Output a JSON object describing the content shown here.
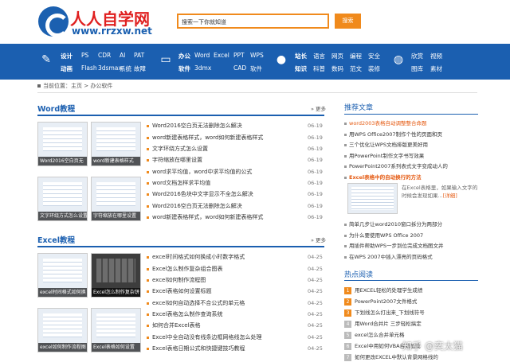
{
  "header": {
    "logo_cn": "人人自学网",
    "logo_en": "www.rrzxw.net",
    "search_placeholder": "搜索一下你就知道",
    "search_button": "搜索"
  },
  "nav": {
    "groups": [
      {
        "icon": "palette-icon",
        "icon_char": "✎",
        "title": "设计",
        "title2": "动画",
        "links": [
          "PS",
          "CDR",
          "AI",
          "PAT",
          "Flash",
          "3dsmax",
          "系统",
          "故障"
        ]
      },
      {
        "icon": "monitor-icon",
        "icon_char": "▭",
        "title": "办公",
        "title2": "软件",
        "links": [
          "Word",
          "Excel",
          "PPT",
          "WPS",
          "3dmx",
          "CAD",
          "软件"
        ]
      },
      {
        "icon": "chat-icon",
        "icon_char": "●",
        "title": "站长",
        "title2": "知识",
        "links": [
          "语言",
          "网页",
          "编程",
          "安全",
          "科普",
          "数码",
          "范文",
          "装修"
        ]
      },
      {
        "icon": "globe-icon",
        "icon_char": "◍",
        "title": "",
        "title2": "",
        "links": [
          "欣赏",
          "视频",
          "图库",
          "素材"
        ]
      }
    ]
  },
  "breadcrumb": {
    "label": "当前位置：",
    "home": "主页",
    "sep": " > ",
    "current": "办公软件"
  },
  "word": {
    "title": "Word教程",
    "more": "更多",
    "thumbs": [
      "Word2016空白页无",
      "word新建表格样式",
      "文字环绕方式怎么设置",
      "字符缩放在哪里设置"
    ],
    "articles": [
      {
        "title": "Word2016空白页无法删除怎么解决",
        "date": "06-19"
      },
      {
        "title": "word新建表格样式，word如何新建表格样式",
        "date": "06-19"
      },
      {
        "title": "文字环绕方式怎么设置",
        "date": "06-19"
      },
      {
        "title": "字符缩放在哪里设置",
        "date": "06-19"
      },
      {
        "title": "word求平均值，word中求平均值的公式",
        "date": "06-19"
      },
      {
        "title": "word文档怎样求平均值",
        "date": "06-19"
      },
      {
        "title": "Word2016色块中文字显示不全怎么解决",
        "date": "06-19"
      },
      {
        "title": "Word2016空白页无法删除怎么解决",
        "date": "06-19"
      },
      {
        "title": "word新建表格样式，word如何新建表格样式",
        "date": "06-19"
      }
    ]
  },
  "excel": {
    "title": "Excel教程",
    "more": "更多",
    "thumbs": [
      "excel时间格式如何换",
      "Excel怎么制作复杂饼",
      "excel如何制作流程图",
      "Excel表格如何设置"
    ],
    "articles": [
      {
        "title": "excel时间格式如何换成小时数字格式",
        "date": "04-25"
      },
      {
        "title": "Excel怎么制作复杂组合图表",
        "date": "04-25"
      },
      {
        "title": "excel如何制作流程图",
        "date": "04-25"
      },
      {
        "title": "Excel表格如何设置标题",
        "date": "04-25"
      },
      {
        "title": "excel如何自动选择不合公式的单元格",
        "date": "04-25"
      },
      {
        "title": "Excel表格怎么制作查询系统",
        "date": "04-25"
      },
      {
        "title": "如何合并Excel表格",
        "date": "04-25"
      },
      {
        "title": "Excel中全自动没有线条边框网格线怎么处理",
        "date": "04-25"
      },
      {
        "title": "Excel表格日期公式和快捷键技巧教程",
        "date": "04-25"
      }
    ]
  },
  "recommend": {
    "title": "推荐文章",
    "items": [
      {
        "text": "word2003表格自动调整整合命题",
        "style": "hl"
      },
      {
        "text": "用WPS Office2007制作个性的页面和页",
        "style": ""
      },
      {
        "text": "三个优化让WPS文档排版更美好用",
        "style": ""
      },
      {
        "text": "用PowerPoint制作文字书写效果",
        "style": ""
      },
      {
        "text": "PowerPoint2007系列表式文字变成动人的",
        "style": ""
      },
      {
        "text": "Excel表格中的自动换行的方法",
        "style": "hl bold"
      }
    ],
    "featured_desc": "在Excel表格里，如果输入文字的时候会发现如果...",
    "featured_link": "[详细]",
    "items2": [
      {
        "text": "简单几步让word2010窗口拆分为两部分"
      },
      {
        "text": "为什么要使用WPS Office 2007"
      },
      {
        "text": "用插件帮助WPS一步到位完成文档图文并"
      },
      {
        "text": "在WPS 2007中插入漂亮的页码格式"
      }
    ]
  },
  "hot": {
    "title": "热点阅读",
    "items": [
      {
        "num": "1",
        "text": "用EXCEL轻松的处理学生成绩"
      },
      {
        "num": "2",
        "text": "PowerPoint2007文件格式"
      },
      {
        "num": "3",
        "text": "下划线怎么打出来_下划线符号"
      },
      {
        "num": "4",
        "text": "用Word合并片 三步轻松搞定"
      },
      {
        "num": "5",
        "text": "excel怎么合并单元格"
      },
      {
        "num": "6",
        "text": "Excel中用如何VBA自动加载"
      },
      {
        "num": "7",
        "text": "如何更改EXCEL中默认背景网格线的"
      }
    ]
  },
  "watermark": "知乎 @奕太猫"
}
